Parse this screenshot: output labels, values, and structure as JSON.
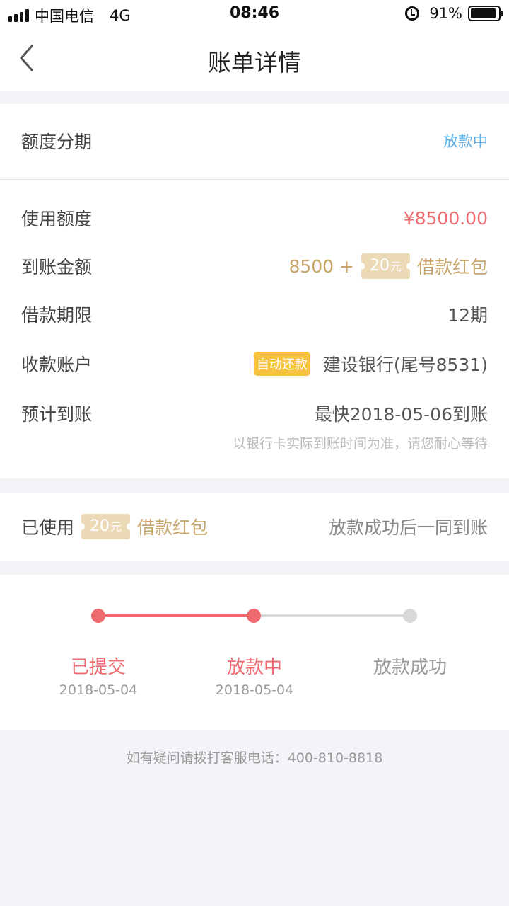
{
  "status_bar": {
    "carrier": "中国电信",
    "network": "4G",
    "time": "08:46",
    "battery_text": "91%",
    "battery_level": 0.91
  },
  "nav": {
    "title": "账单详情"
  },
  "summary": {
    "label": "额度分期",
    "status": "放款中"
  },
  "details": {
    "used_credit": {
      "label": "使用额度",
      "value": "¥8500.00"
    },
    "received_amount": {
      "label": "到账金额",
      "base": "8500 +",
      "coupon_amount": "20",
      "coupon_unit": "元",
      "coupon_name": "借款红包"
    },
    "term": {
      "label": "借款期限",
      "value": "12期"
    },
    "account": {
      "label": "收款账户",
      "tag": "自动还款",
      "value": "建设银行(尾号8531)"
    },
    "eta": {
      "label": "预计到账",
      "value": "最快2018-05-06到账",
      "hint": "以银行卡实际到账时间为准，请您耐心等待"
    }
  },
  "coupon_row": {
    "label": "已使用",
    "coupon_amount": "20",
    "coupon_unit": "元",
    "coupon_name": "借款红包",
    "note": "放款成功后一同到账"
  },
  "progress": {
    "steps": [
      {
        "label": "已提交",
        "date": "2018-05-04"
      },
      {
        "label": "放款中",
        "date": "2018-05-04"
      },
      {
        "label": "放款成功",
        "date": ""
      }
    ]
  },
  "colors": {
    "accent_red": "#ef6a6f",
    "gold": "#c7a56d",
    "blue": "#5faee8",
    "inactive": "#d9d9d9"
  },
  "footer": {
    "note": "如有疑问请拨打客服电话：400-810-8818"
  }
}
